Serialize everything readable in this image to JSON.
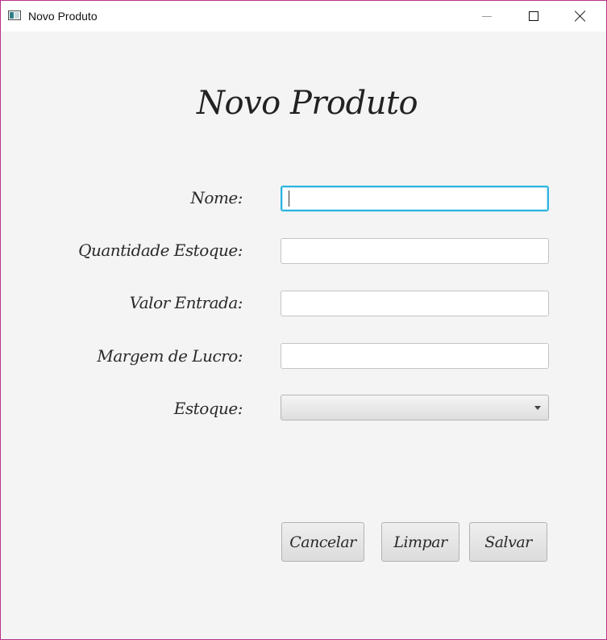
{
  "window": {
    "title": "Novo Produto"
  },
  "form": {
    "heading": "Novo Produto",
    "fields": [
      {
        "label": "Nome:",
        "value": ""
      },
      {
        "label": "Quantidade Estoque:",
        "value": ""
      },
      {
        "label": "Valor Entrada:",
        "value": ""
      },
      {
        "label": "Margem de Lucro:",
        "value": ""
      }
    ],
    "estoque": {
      "label": "Estoque:",
      "selected": ""
    }
  },
  "buttons": {
    "cancelar": "Cancelar",
    "limpar": "Limpar",
    "salvar": "Salvar"
  },
  "colors": {
    "focus": "#2bb4e0",
    "window_border": "#b8328c"
  }
}
